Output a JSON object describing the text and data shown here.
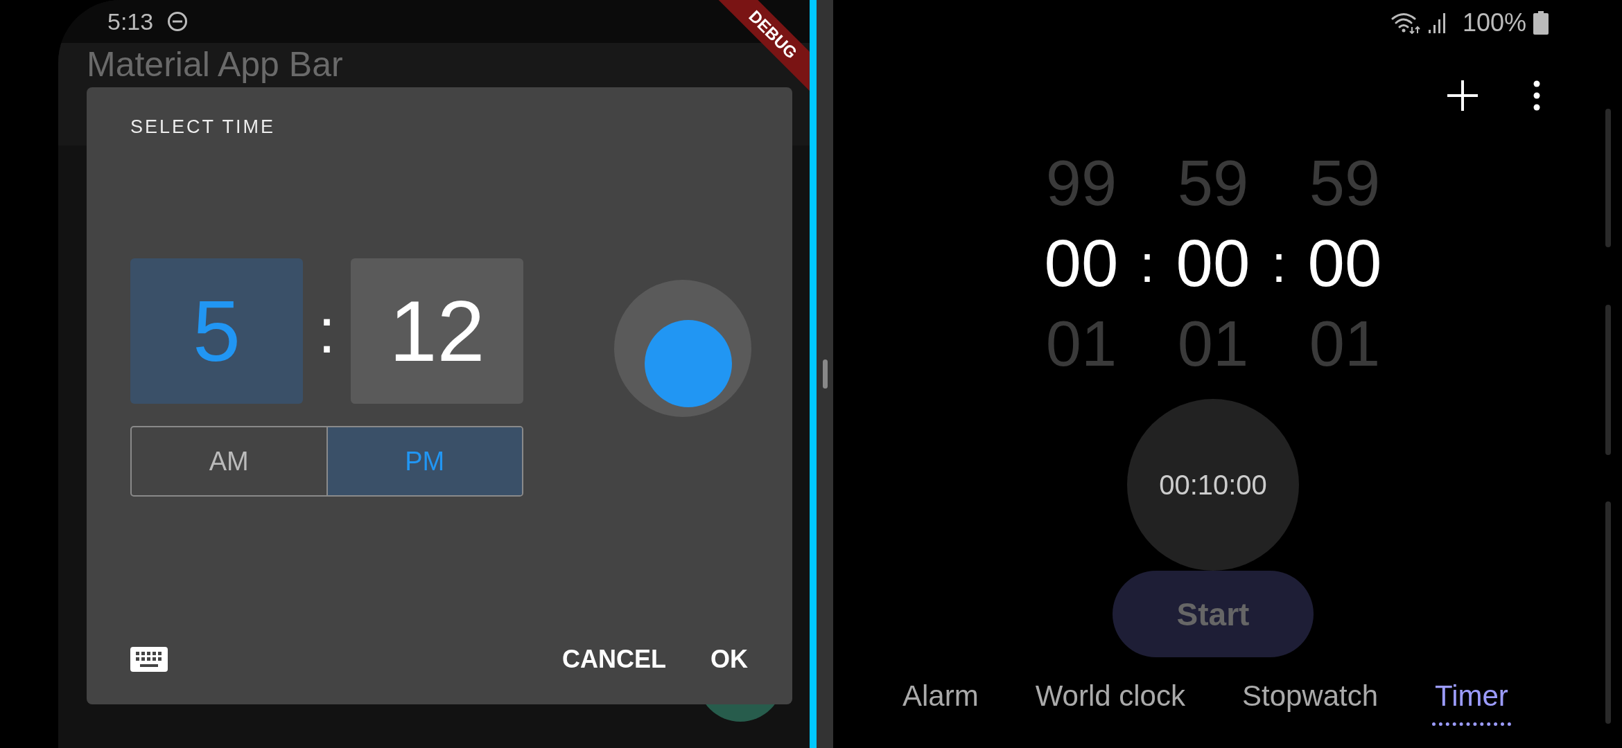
{
  "left_app": {
    "status_bar": {
      "time": "5:13"
    },
    "app_bar": {
      "title": "Material App Bar"
    },
    "debug_banner": "DEBUG",
    "dialog": {
      "title": "SELECT TIME",
      "hour": {
        "value": "5",
        "selected": true
      },
      "separator": ":",
      "minute": {
        "value": "12",
        "selected": false
      },
      "periods": [
        {
          "label": "AM",
          "selected": false
        },
        {
          "label": "PM",
          "selected": true
        }
      ],
      "actions": [
        "CANCEL",
        "OK"
      ]
    }
  },
  "right_app": {
    "status_bar": {
      "battery": "100%"
    },
    "picker": {
      "columns": [
        {
          "above": "99",
          "value": "00",
          "below": "01"
        },
        {
          "above": "59",
          "value": "00",
          "below": "01"
        },
        {
          "above": "59",
          "value": "00",
          "below": "01"
        }
      ],
      "separators": [
        ":",
        ":"
      ]
    },
    "preset": "00:10:00",
    "start_button": {
      "label": "Start",
      "disabled": true
    },
    "tabs": [
      {
        "label": "Alarm",
        "selected": false
      },
      {
        "label": "World clock",
        "selected": false
      },
      {
        "label": "Stopwatch",
        "selected": false
      },
      {
        "label": "Timer",
        "selected": true
      }
    ]
  }
}
